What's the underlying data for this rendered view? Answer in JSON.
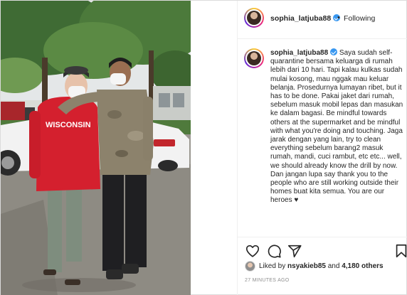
{
  "header": {
    "username": "sophia_latjuba88",
    "separator": "•",
    "follow_state": "Following"
  },
  "caption": {
    "username": "sophia_latjuba88",
    "text": "Saya sudah self-quarantine bersama keluarga di rumah lebih dari 10 hari. Tapi kalau kulkas sudah mulai kosong, mau nggak mau keluar belanja. Prosedurnya lumayan ribet, but it has to be done. Pakai jaket dari rumah, sebelum masuk mobil lepas dan masukan ke dalam bagasi. Be mindful towards others at the supermarket and be mindful with what you're doing and touching. Jaga jarak dengan yang lain, try to clean everything sebelum barang2 masuk rumah, mandi, cuci rambut, etc etc... well, we should already know the drill by now. Dan jangan lupa say thank you to the people who are still working outside their homes buat kita semua. You are our heroes ♥"
  },
  "photo": {
    "hoodie_text": "WISCONSIN"
  },
  "actions": {
    "like_icon": "heart-outline-icon",
    "comment_icon": "comment-icon",
    "share_icon": "paper-plane-icon",
    "save_icon": "bookmark-icon"
  },
  "likes": {
    "prefix": "Liked by ",
    "user": "nsyakieb85",
    "middle": " and ",
    "count": "4,180 others"
  },
  "timestamp": "27 MINUTES AGO",
  "colors": {
    "verified": "#3897f0",
    "text": "#262626",
    "muted": "#8e8e8e",
    "border": "#efefef"
  }
}
